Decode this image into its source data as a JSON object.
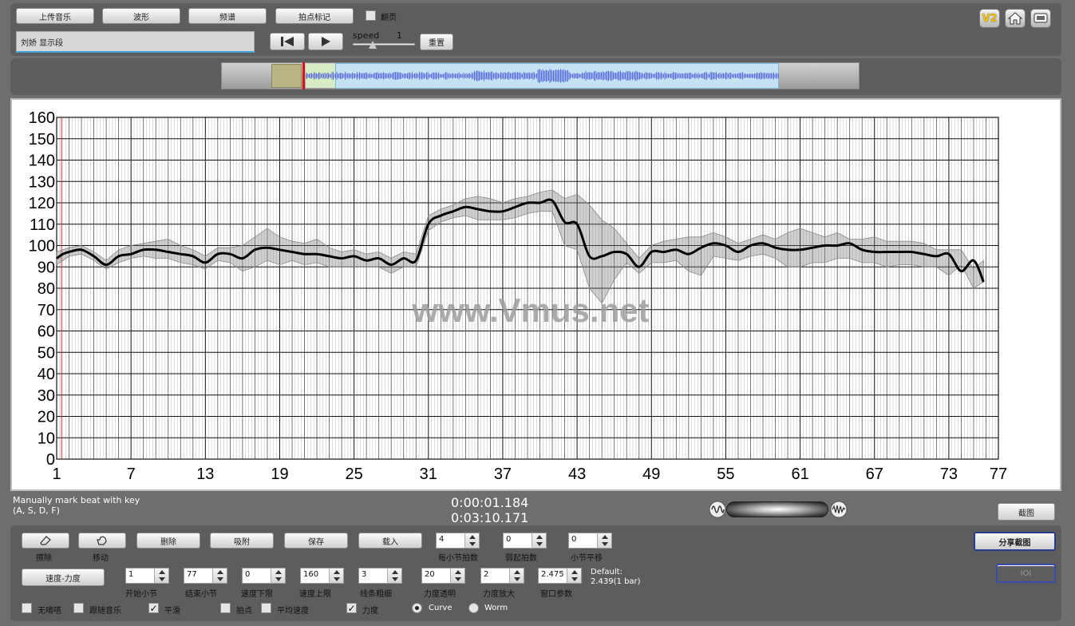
{
  "toolbar": {
    "upload_label": "上传音乐",
    "waveform_label": "波形",
    "spectrum_label": "频谱",
    "beatmark_label": "拍点标记",
    "page_flip_label": "翻页",
    "title_value": "刘娇 显示段",
    "speed_label": "speed",
    "speed_value": "1",
    "reset_label": "重置",
    "v2_label": "V2"
  },
  "chart_data": {
    "type": "line",
    "ylim": [
      0,
      160
    ],
    "yticks": [
      0,
      10,
      20,
      30,
      40,
      50,
      60,
      70,
      80,
      90,
      100,
      110,
      120,
      130,
      140,
      150,
      160
    ],
    "xlim": [
      1,
      77
    ],
    "xticks": [
      1,
      7,
      13,
      19,
      25,
      31,
      37,
      43,
      49,
      55,
      61,
      67,
      73,
      77
    ],
    "watermark": "www.Vmus.net",
    "series": [
      {
        "kind": "curve",
        "x": [
          1,
          1.5,
          2,
          3,
          4,
          5,
          6,
          7,
          8,
          9,
          10,
          11,
          12,
          13,
          14,
          15,
          16,
          17,
          18,
          19,
          20,
          21,
          22,
          23,
          24,
          25,
          26,
          27,
          28,
          29,
          30,
          31,
          32,
          33,
          34,
          35,
          36,
          37,
          38,
          39,
          40,
          41,
          42,
          43,
          44,
          45,
          46,
          47,
          48,
          49,
          50,
          51,
          52,
          53,
          54,
          55,
          56,
          57,
          58,
          59,
          60,
          61,
          62,
          63,
          64,
          65,
          66,
          67,
          68,
          69,
          70,
          71,
          72,
          73,
          74,
          75,
          75.8
        ],
        "y": [
          94,
          96,
          97,
          98,
          95,
          91,
          95,
          96,
          98,
          98,
          97,
          96,
          95,
          92,
          96,
          96,
          94,
          98,
          99,
          98,
          97,
          96,
          96,
          95,
          94,
          95,
          93,
          94,
          91,
          94,
          93,
          110,
          114,
          116,
          118,
          117,
          116,
          116,
          118,
          120,
          120,
          121,
          111,
          110,
          95,
          95,
          97,
          96,
          90,
          97,
          97,
          98,
          96,
          99,
          101,
          100,
          97,
          100,
          101,
          99,
          98,
          98,
          99,
          100,
          100,
          101,
          98,
          97,
          97,
          97,
          97,
          96,
          95,
          96,
          88,
          93,
          83
        ]
      }
    ],
    "band": {
      "x": [
        1,
        2,
        3,
        4,
        5,
        6,
        7,
        8,
        9,
        10,
        11,
        12,
        13,
        14,
        15,
        16,
        17,
        18,
        19,
        20,
        21,
        22,
        23,
        24,
        25,
        26,
        27,
        28,
        29,
        30,
        31,
        32,
        33,
        34,
        35,
        36,
        37,
        38,
        39,
        40,
        41,
        42,
        43,
        44,
        45,
        46,
        47,
        48,
        49,
        50,
        51,
        52,
        53,
        54,
        55,
        56,
        57,
        58,
        59,
        60,
        61,
        62,
        63,
        64,
        65,
        66,
        67,
        68,
        69,
        70,
        71,
        72,
        73,
        74,
        75,
        75.8
      ],
      "upper": [
        97,
        99,
        100,
        97,
        93,
        98,
        100,
        101,
        102,
        103,
        100,
        98,
        95,
        99,
        99,
        100,
        104,
        108,
        104,
        102,
        101,
        103,
        99,
        97,
        98,
        96,
        97,
        94,
        97,
        96,
        114,
        117,
        119,
        122,
        123,
        122,
        120,
        122,
        123,
        125,
        126,
        122,
        124,
        119,
        112,
        108,
        101,
        94,
        100,
        102,
        103,
        104,
        104,
        106,
        104,
        101,
        103,
        105,
        103,
        106,
        108,
        106,
        104,
        106,
        103,
        103,
        104,
        102,
        102,
        102,
        101,
        98,
        98,
        98,
        89,
        93,
        85
      ],
      "lower": [
        91,
        95,
        96,
        93,
        89,
        92,
        94,
        95,
        94,
        94,
        92,
        91,
        89,
        93,
        92,
        88,
        90,
        93,
        91,
        93,
        91,
        92,
        90,
        90,
        90,
        90,
        90,
        87,
        90,
        90,
        107,
        111,
        113,
        114,
        112,
        112,
        112,
        113,
        115,
        116,
        116,
        100,
        98,
        80,
        73,
        84,
        92,
        87,
        92,
        92,
        93,
        88,
        86,
        95,
        94,
        93,
        95,
        96,
        94,
        90,
        90,
        92,
        92,
        94,
        94,
        92,
        92,
        90,
        91,
        91,
        90,
        90,
        86,
        91,
        80,
        83
      ],
      "note": ""
    },
    "grid": true,
    "title": "",
    "xlabel": "",
    "ylabel": ""
  },
  "status": {
    "manual_line1": "Manually mark beat with key",
    "manual_line2": "(A, S, D, F)",
    "time_current": "0:00:01.184",
    "time_total": "0:03:10.171",
    "screenshot_label": "截图",
    "share_label": "分享截图",
    "ioi_label": "IOI"
  },
  "controls": {
    "erase_label": "擦除",
    "move_label": "移动",
    "delete_label": "删除",
    "snap_label": "吸附",
    "save_label": "保存",
    "load_label": "载入",
    "tempo_dyn_label": "速度-力度",
    "beats_per_bar": {
      "value": "4",
      "caption": "每小节拍数"
    },
    "pickup_beats": {
      "value": "0",
      "caption": "弱起拍数"
    },
    "bar_shift": {
      "value": "0",
      "caption": "小节平移"
    },
    "start_bar": {
      "value": "1",
      "caption": "开始小节"
    },
    "end_bar": {
      "value": "77",
      "caption": "结束小节"
    },
    "tempo_min": {
      "value": "0",
      "caption": "速度下限"
    },
    "tempo_max": {
      "value": "160",
      "caption": "速度上限"
    },
    "line_width": {
      "value": "3",
      "caption": "线条粗细"
    },
    "dyn_opacity": {
      "value": "20",
      "caption": "力度透明"
    },
    "dyn_zoom": {
      "value": "2",
      "caption": "力度放大"
    },
    "window_param": {
      "value": "2.475",
      "caption": "窗口参数"
    },
    "default_line1": "Default:",
    "default_line2": "2.439(1 bar)",
    "no_beep": "无嘀嗒",
    "follow_music": "跟随音乐",
    "smooth": "平滑",
    "beat_points": "拍点",
    "avg_tempo": "平均速度",
    "dynamics": "力度",
    "curve": "Curve",
    "worm": "Worm",
    "checkmark": "✓"
  }
}
